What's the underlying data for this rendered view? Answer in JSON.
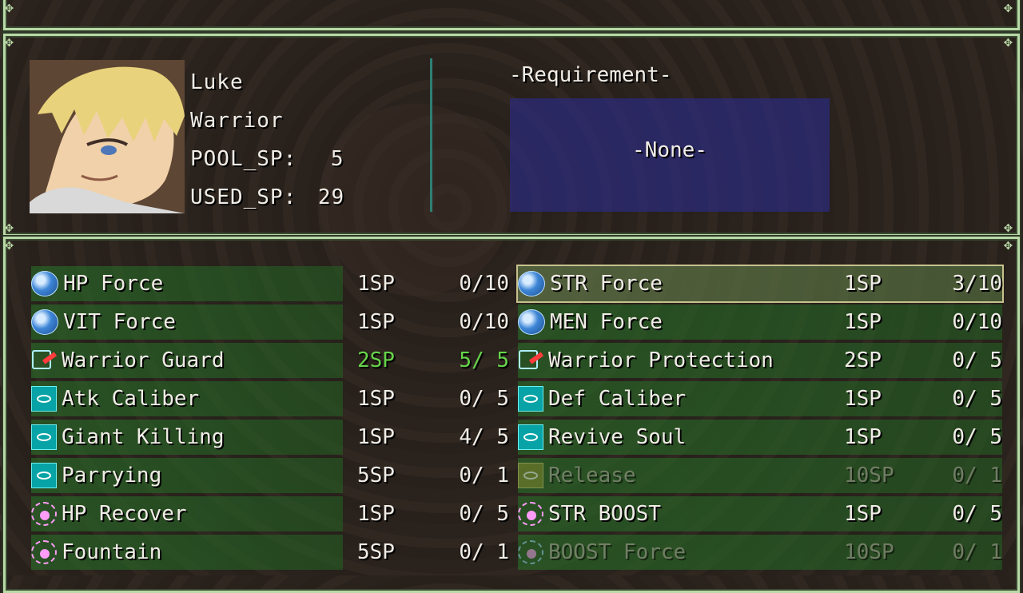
{
  "window": {
    "character": {
      "name": "Luke",
      "class": "Warrior",
      "pool_sp_label": "POOL_SP:",
      "pool_sp_value": "5",
      "used_sp_label": "USED_SP:",
      "used_sp_value": "29"
    },
    "requirement": {
      "title": "-Requirement-",
      "value": "-None-"
    }
  },
  "skills": {
    "left": [
      {
        "icon": "blue-orb-icon",
        "name": "HP Force",
        "cost": "1SP",
        "level": "0/10",
        "state": "normal"
      },
      {
        "icon": "blue-orb-icon",
        "name": "VIT Force",
        "cost": "1SP",
        "level": "0/10",
        "state": "normal"
      },
      {
        "icon": "warrior-guard-icon",
        "name": "Warrior Guard",
        "cost": "2SP",
        "level": "5/ 5",
        "state": "maxed"
      },
      {
        "icon": "eye-icon",
        "name": "Atk Caliber",
        "cost": "1SP",
        "level": "0/ 5",
        "state": "normal"
      },
      {
        "icon": "eye-icon",
        "name": "Giant Killing",
        "cost": "1SP",
        "level": "4/ 5",
        "state": "normal"
      },
      {
        "icon": "eye-icon",
        "name": "Parrying",
        "cost": "5SP",
        "level": "0/ 1",
        "state": "normal"
      },
      {
        "icon": "pink-gear-icon",
        "name": "HP Recover",
        "cost": "1SP",
        "level": "0/ 5",
        "state": "normal"
      },
      {
        "icon": "pink-gear-icon",
        "name": "Fountain",
        "cost": "5SP",
        "level": "0/ 1",
        "state": "normal"
      }
    ],
    "right": [
      {
        "icon": "blue-orb-icon",
        "name": "STR Force",
        "cost": "1SP",
        "level": "3/10",
        "state": "selected"
      },
      {
        "icon": "blue-orb-icon",
        "name": "MEN Force",
        "cost": "1SP",
        "level": "0/10",
        "state": "normal"
      },
      {
        "icon": "warrior-guard-icon",
        "name": "Warrior Protection",
        "cost": "2SP",
        "level": "0/ 5",
        "state": "normal"
      },
      {
        "icon": "eye-icon",
        "name": "Def Caliber",
        "cost": "1SP",
        "level": "0/ 5",
        "state": "normal"
      },
      {
        "icon": "eye-icon",
        "name": "Revive Soul",
        "cost": "1SP",
        "level": "0/ 5",
        "state": "normal"
      },
      {
        "icon": "yellow-eye-icon",
        "name": "Release",
        "cost": "10SP",
        "level": "0/ 1",
        "state": "disabled"
      },
      {
        "icon": "pink-gear-icon",
        "name": "STR BOOST",
        "cost": "1SP",
        "level": "0/ 5",
        "state": "normal"
      },
      {
        "icon": "blue-gear-icon",
        "name": "BOOST Force",
        "cost": "10SP",
        "level": "0/ 1",
        "state": "disabled"
      }
    ]
  },
  "colors": {
    "frame": "#b9d9a6",
    "maxed": "#66d44a",
    "requirement_box": "#2c2c8c"
  }
}
